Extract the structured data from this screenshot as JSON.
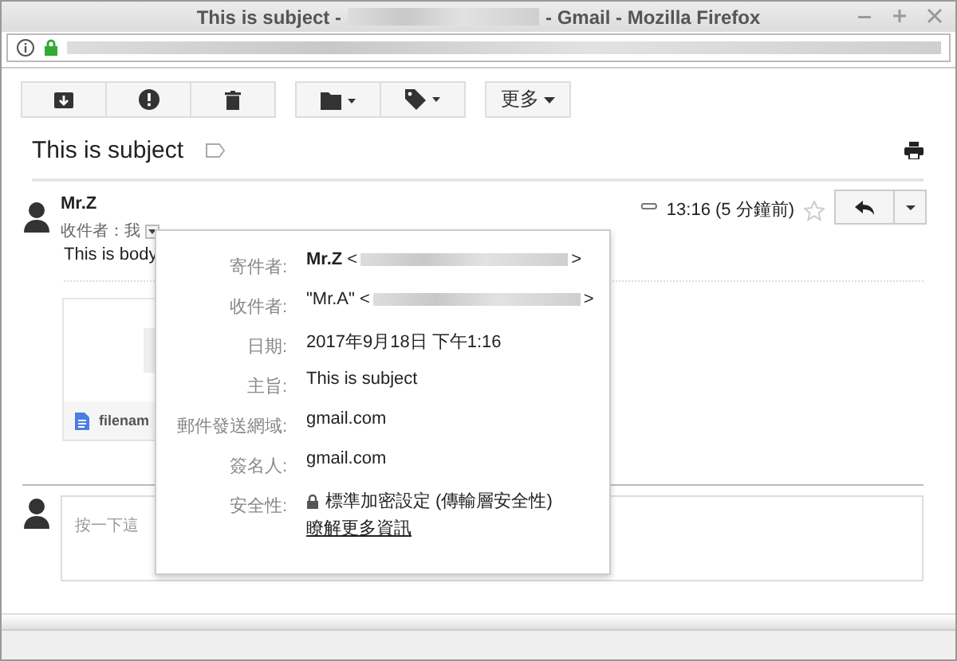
{
  "window": {
    "title_start": "This is subject -",
    "title_end": "- Gmail - Mozilla Firefox"
  },
  "toolbar": {
    "more_button": "更多"
  },
  "subject": "This is subject",
  "message": {
    "sender": "Mr.Z",
    "recipient_line": "收件者：我",
    "time": "13:16 (5 分鐘前)",
    "starred": false,
    "has_attachment": true,
    "body": "This is body",
    "attachment_name": "filenam"
  },
  "details_popup": {
    "rows": [
      {
        "kind": "address",
        "label": "寄件者:",
        "value": "**Mr.Z** <",
        "after": ">"
      },
      {
        "kind": "address",
        "label": "收件者:",
        "value": "\"Mr.A\" <",
        "after": ">"
      },
      {
        "kind": "text",
        "label": "日期:",
        "value": "2017年9月18日 下午1:16"
      },
      {
        "kind": "text",
        "label": "主旨:",
        "value": "This is subject"
      },
      {
        "kind": "text",
        "label": "郵件發送網域:",
        "value": "gmail.com"
      },
      {
        "kind": "text",
        "label": "簽名人:",
        "value": "gmail.com"
      },
      {
        "kind": "security",
        "label": "安全性:",
        "value": "標準加密設定 (傳輸層安全性)",
        "link": "瞭解更多資訊"
      }
    ]
  },
  "reply": {
    "placeholder": "按一下這"
  }
}
